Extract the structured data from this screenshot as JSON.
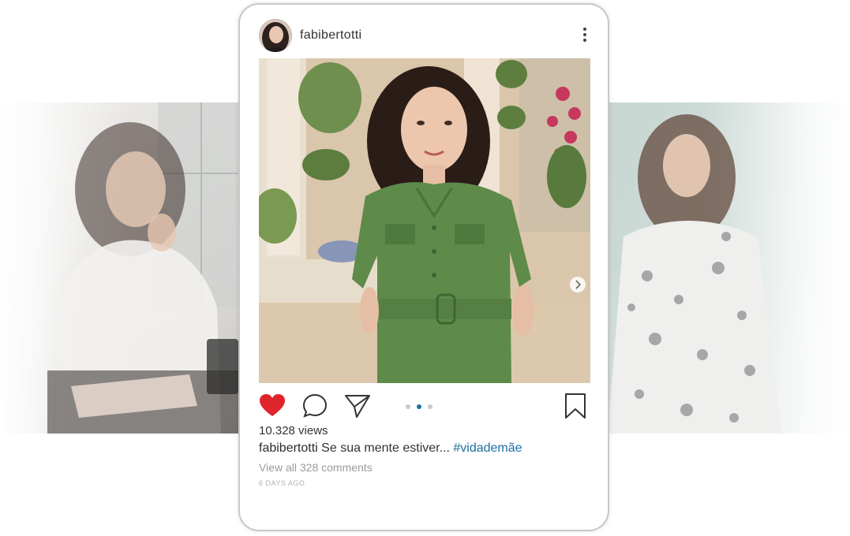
{
  "post": {
    "username": "fabibertotti",
    "views": "10.328 views",
    "caption_user": "fabibertotti",
    "caption_text": "Se sua mente estiver...",
    "hashtag": "#vidademãe",
    "comments_link": "View all 328 comments",
    "timestamp": "6 DAYS AGO"
  },
  "carousel": {
    "count": 3,
    "active_index": 1
  },
  "icons": {
    "more": "more-vertical-icon",
    "like": "heart-filled-icon",
    "comment": "comment-bubble-icon",
    "share": "paper-plane-icon",
    "save": "bookmark-icon",
    "next": "chevron-right-icon"
  },
  "colors": {
    "like": "#e0242c",
    "hashtag": "#1d6fa4",
    "active_dot": "#1d6fa4",
    "dress": "#5e8b4a"
  }
}
